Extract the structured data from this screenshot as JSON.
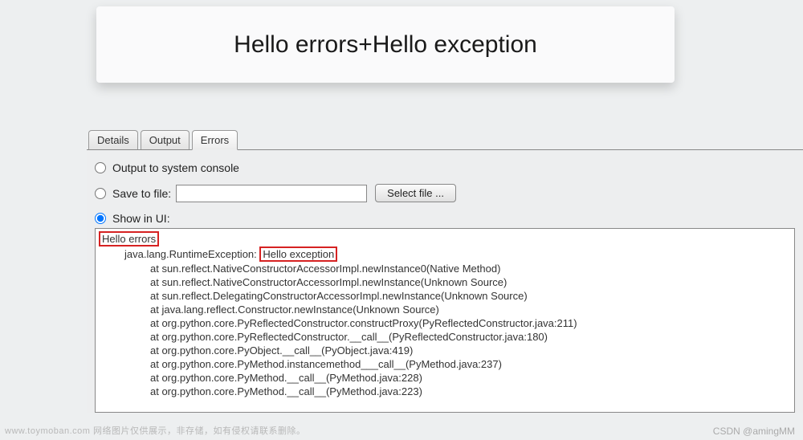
{
  "title": "Hello errors+Hello exception",
  "tabs": [
    {
      "label": "Details",
      "active": false
    },
    {
      "label": "Output",
      "active": false
    },
    {
      "label": "Errors",
      "active": true
    }
  ],
  "options": {
    "console_label": "Output to system console",
    "save_label": "Save to file:",
    "save_value": "",
    "select_button": "Select file ...",
    "show_label": "Show in UI:"
  },
  "trace": {
    "error_msg": "Hello errors",
    "exception_prefix": "java.lang.RuntimeException: ",
    "exception_msg": "Hello exception",
    "lines": [
      "at sun.reflect.NativeConstructorAccessorImpl.newInstance0(Native Method)",
      "at sun.reflect.NativeConstructorAccessorImpl.newInstance(Unknown Source)",
      "at sun.reflect.DelegatingConstructorAccessorImpl.newInstance(Unknown Source)",
      "at java.lang.reflect.Constructor.newInstance(Unknown Source)",
      "at org.python.core.PyReflectedConstructor.constructProxy(PyReflectedConstructor.java:211)",
      "at org.python.core.PyReflectedConstructor.__call__(PyReflectedConstructor.java:180)",
      "at org.python.core.PyObject.__call__(PyObject.java:419)",
      "at org.python.core.PyMethod.instancemethod___call__(PyMethod.java:237)",
      "at org.python.core.PyMethod.__call__(PyMethod.java:228)",
      "at org.python.core.PyMethod.__call__(PyMethod.java:223)"
    ]
  },
  "watermark_left": "www.toymoban.com  网络图片仅供展示，非存储，如有侵权请联系删除。",
  "watermark_right": "CSDN @amingMM"
}
